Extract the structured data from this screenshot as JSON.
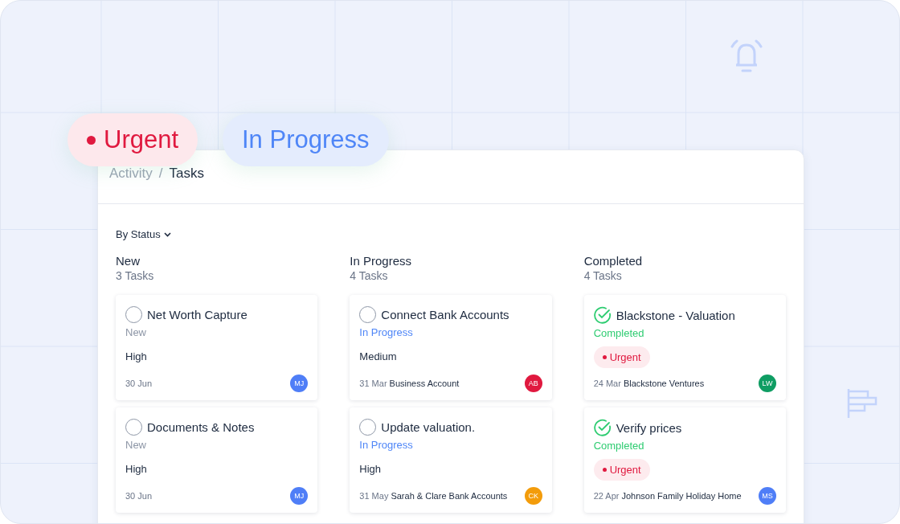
{
  "floating_tags": [
    {
      "label": "Urgent",
      "kind": "urgent"
    },
    {
      "label": "In Progress",
      "kind": "progress"
    }
  ],
  "breadcrumb": [
    "Activity",
    "/",
    "Tasks"
  ],
  "filter": {
    "label": "By Status"
  },
  "columns": [
    {
      "title": "New",
      "count": "3 Tasks",
      "tasks": [
        {
          "title": "Net Worth Capture",
          "done": false,
          "status": {
            "label": "New",
            "color": "#8d96a6"
          },
          "priority": {
            "kind": "text",
            "label": "High"
          },
          "date": "30 Jun",
          "avatar": {
            "initials": "MJ",
            "color": "#4f7ef7"
          }
        },
        {
          "title": "Documents & Notes",
          "done": false,
          "status": {
            "label": "New",
            "color": "#8d96a6"
          },
          "priority": {
            "kind": "text",
            "label": "High"
          },
          "date": "30 Jun",
          "avatar": {
            "initials": "MJ",
            "color": "#4f7ef7"
          }
        }
      ]
    },
    {
      "title": "In Progress",
      "count": "4 Tasks",
      "tasks": [
        {
          "title": "Connect Bank Accounts",
          "done": false,
          "status": {
            "label": "In Progress",
            "color": "#4f86f7"
          },
          "priority": {
            "kind": "text",
            "label": "Medium"
          },
          "date": "31 Mar",
          "account": "Business Account",
          "avatar": {
            "initials": "AB",
            "color": "#e0193f"
          }
        },
        {
          "title": "Update valuation.",
          "done": false,
          "status": {
            "label": "In Progress",
            "color": "#4f86f7"
          },
          "priority": {
            "kind": "text",
            "label": "High"
          },
          "date": "31 May",
          "account": "Sarah & Clare Bank Accounts",
          "avatar": {
            "initials": "CK",
            "color": "#f39c0b"
          }
        }
      ]
    },
    {
      "title": "Completed",
      "count": "4 Tasks",
      "tasks": [
        {
          "title": "Blackstone - Valuation",
          "done": true,
          "status": {
            "label": "Completed",
            "color": "#2ecc71"
          },
          "priority": {
            "kind": "badge",
            "label": "Urgent"
          },
          "date": "24 Mar",
          "account": "Blackstone Ventures",
          "avatar": {
            "initials": "LW",
            "color": "#0f9d63"
          }
        },
        {
          "title": "Verify prices",
          "done": true,
          "status": {
            "label": "Completed",
            "color": "#2ecc71"
          },
          "priority": {
            "kind": "badge",
            "label": "Urgent"
          },
          "date": "22 Apr",
          "account": "Johnson Family Holiday Home",
          "avatar": {
            "initials": "MS",
            "color": "#4f7ef7"
          }
        }
      ]
    }
  ]
}
